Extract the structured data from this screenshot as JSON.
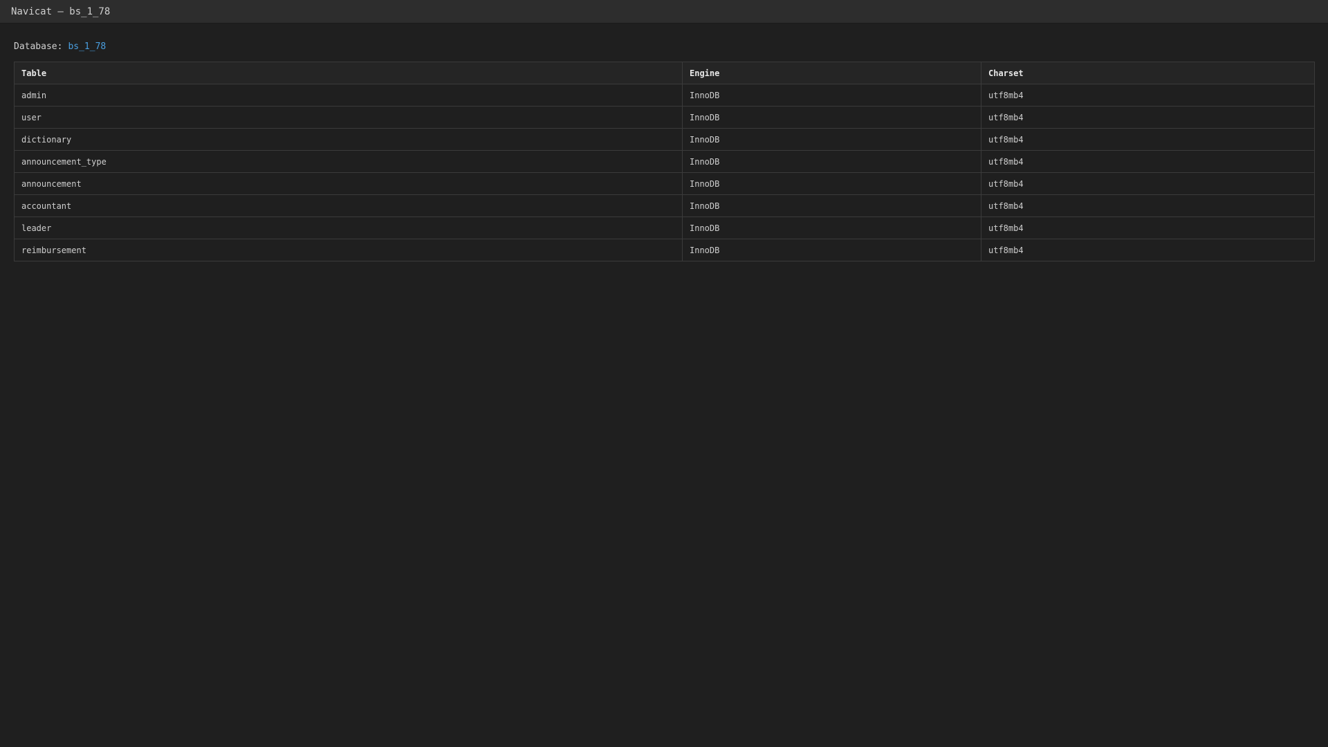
{
  "window": {
    "title": "Navicat — bs_1_78"
  },
  "database": {
    "label": "Database:",
    "name": "bs_1_78"
  },
  "table": {
    "columns": [
      "Table",
      "Engine",
      "Charset"
    ],
    "rows": [
      {
        "name": "admin",
        "engine": "InnoDB",
        "charset": "utf8mb4"
      },
      {
        "name": "user",
        "engine": "InnoDB",
        "charset": "utf8mb4"
      },
      {
        "name": "dictionary",
        "engine": "InnoDB",
        "charset": "utf8mb4"
      },
      {
        "name": "announcement_type",
        "engine": "InnoDB",
        "charset": "utf8mb4"
      },
      {
        "name": "announcement",
        "engine": "InnoDB",
        "charset": "utf8mb4"
      },
      {
        "name": "accountant",
        "engine": "InnoDB",
        "charset": "utf8mb4"
      },
      {
        "name": "leader",
        "engine": "InnoDB",
        "charset": "utf8mb4"
      },
      {
        "name": "reimbursement",
        "engine": "InnoDB",
        "charset": "utf8mb4"
      }
    ]
  },
  "colors": {
    "background": "#1f1f1f",
    "titlebar": "#2d2d2d",
    "accent": "#4a9fe0",
    "border": "#3b3b3b"
  }
}
